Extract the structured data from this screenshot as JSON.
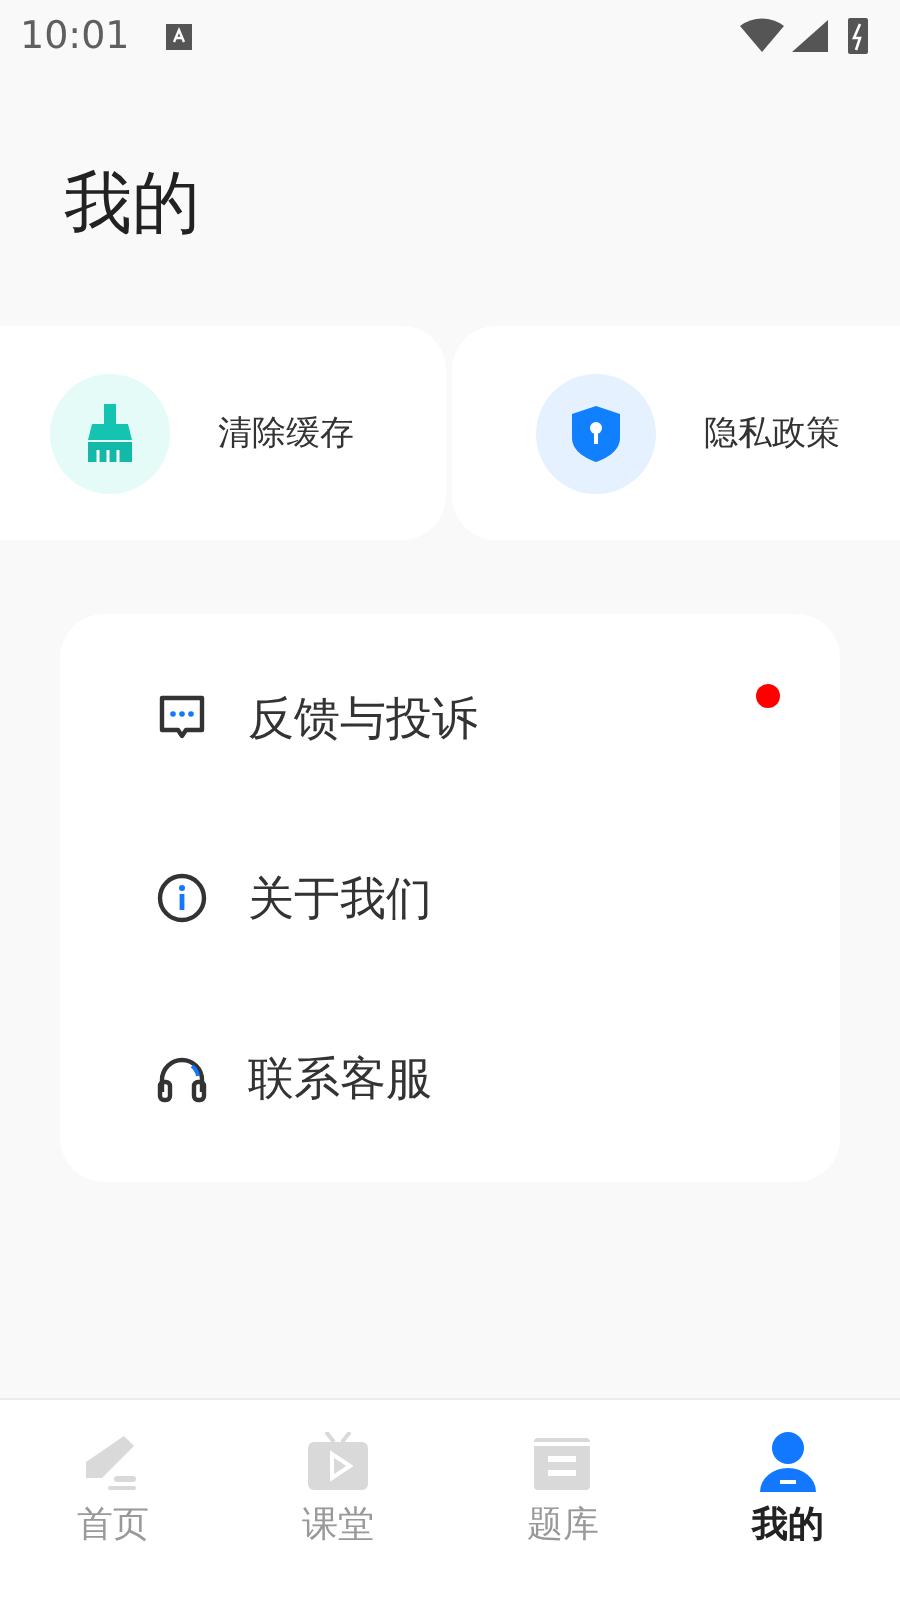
{
  "status_bar": {
    "time": "10:01"
  },
  "title": "我的",
  "quick_actions": [
    {
      "label": "清除缓存",
      "kind": "broom"
    },
    {
      "label": "隐私政策",
      "kind": "shield"
    }
  ],
  "menu": [
    {
      "label": "反馈与投诉",
      "kind": "feedback",
      "badge": true
    },
    {
      "label": "关于我们",
      "kind": "info",
      "badge": false
    },
    {
      "label": "联系客服",
      "kind": "headset",
      "badge": false
    }
  ],
  "tabs": [
    {
      "label": "首页",
      "kind": "home",
      "selected": false
    },
    {
      "label": "课堂",
      "kind": "class",
      "selected": false
    },
    {
      "label": "题库",
      "kind": "bank",
      "selected": false
    },
    {
      "label": "我的",
      "kind": "me",
      "selected": true
    }
  ]
}
